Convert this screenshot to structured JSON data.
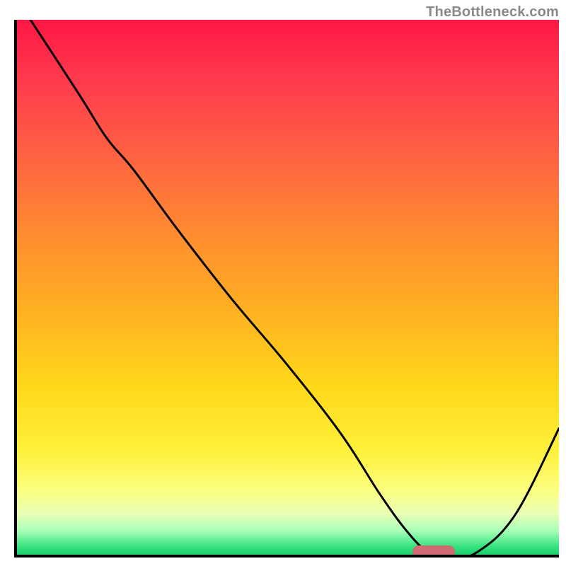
{
  "attribution": "TheBottleneck.com",
  "chart_data": {
    "type": "line",
    "title": "",
    "xlabel": "",
    "ylabel": "",
    "xlim": [
      0,
      100
    ],
    "ylim": [
      0,
      100
    ],
    "grid": false,
    "legend": false,
    "series": [
      {
        "name": "bottleneck-curve",
        "x": [
          3,
          12,
          17,
          22,
          30,
          40,
          50,
          60,
          67,
          72,
          76,
          80,
          85,
          92,
          100
        ],
        "y": [
          100,
          86,
          78,
          72,
          61,
          48,
          36,
          23,
          12,
          5,
          1,
          0,
          1,
          8,
          24
        ]
      }
    ],
    "marker": {
      "x": 77,
      "y": 1
    },
    "colors": {
      "curve": "#000000",
      "marker": "#d16a72",
      "axis": "#000000"
    }
  }
}
